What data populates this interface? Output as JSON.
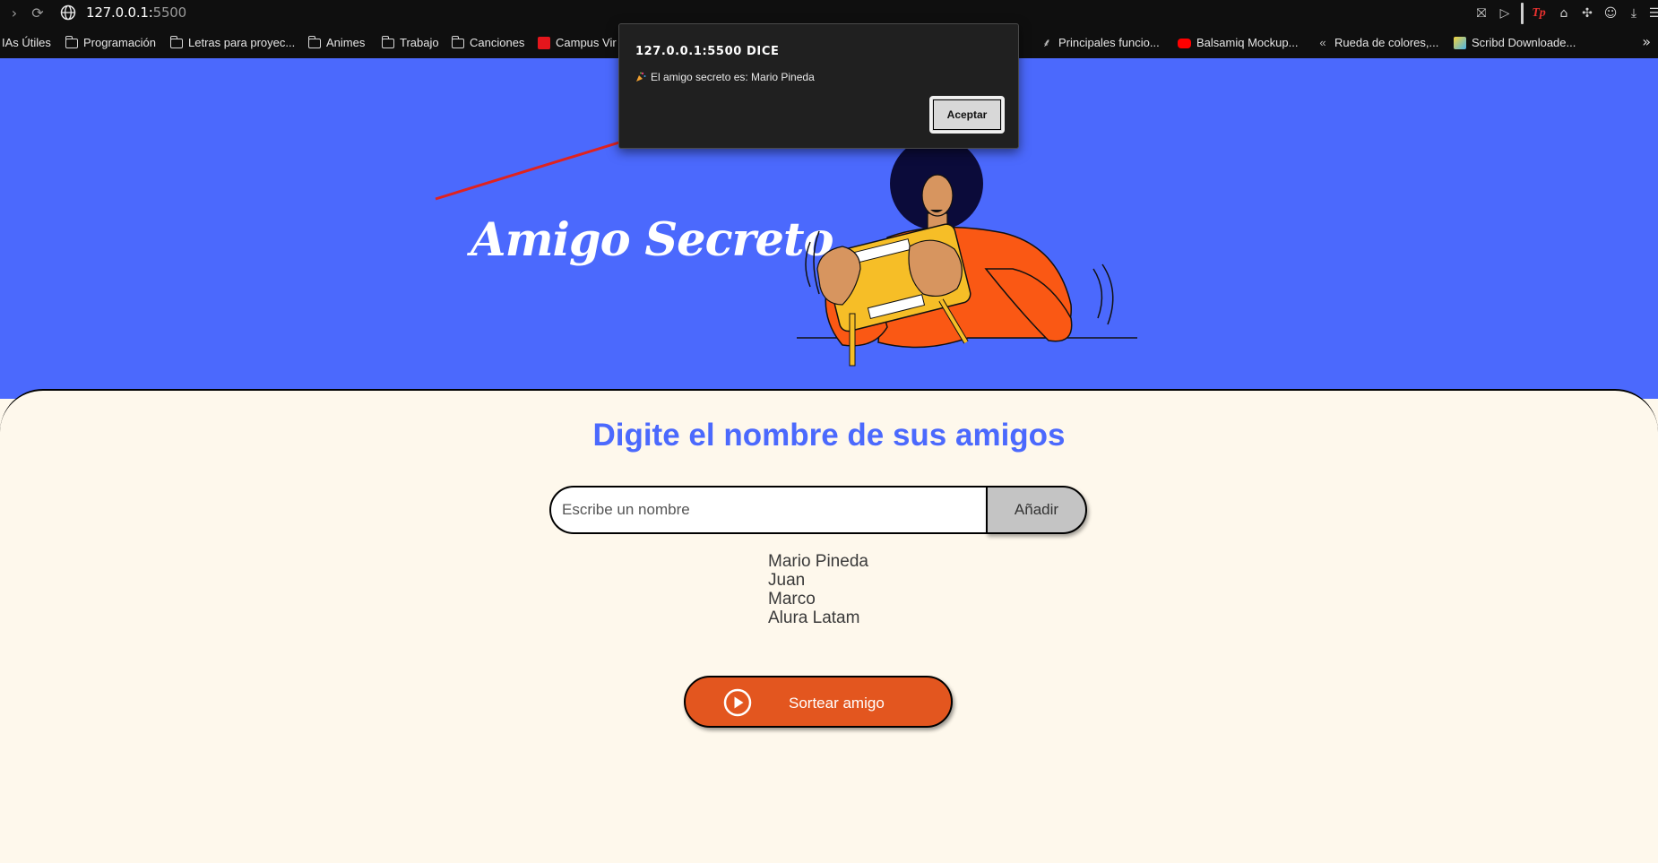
{
  "browser": {
    "url_host": "127.0.0.1:",
    "url_port": "5500",
    "bookmarks": [
      {
        "label": "IAs Útiles",
        "icon": "none"
      },
      {
        "label": "Programación",
        "icon": "folder-icon"
      },
      {
        "label": "Letras para proyec...",
        "icon": "folder-icon"
      },
      {
        "label": "Animes",
        "icon": "folder-icon"
      },
      {
        "label": "Trabajo",
        "icon": "folder-icon"
      },
      {
        "label": "Canciones",
        "icon": "folder-icon"
      },
      {
        "label": "Campus Vir",
        "icon": "campus-favicon"
      },
      {
        "label": "Principales funcio...",
        "icon": "feather-favicon"
      },
      {
        "label": "Balsamiq Mockup...",
        "icon": "youtube-favicon"
      },
      {
        "label": "Rueda de colores,...",
        "icon": "color-wheel-favicon"
      },
      {
        "label": "Scribd Downloade...",
        "icon": "scribd-favicon"
      }
    ]
  },
  "dialog": {
    "title": "127.0.0.1:5500 DICE",
    "message": "El amigo secreto es: Mario Pineda",
    "ok_label": "Aceptar"
  },
  "hero": {
    "title": "Amigo Secreto"
  },
  "main": {
    "subtitle": "Digite el nombre de sus amigos",
    "input_placeholder": "Escribe un nombre",
    "add_label": "Añadir",
    "friends": [
      "Mario Pineda",
      "Juan",
      "Marco",
      "Alura Latam"
    ],
    "draw_label": "Sortear amigo"
  },
  "colors": {
    "hero_bg": "#4b69fd",
    "content_bg": "#fef8ec",
    "accent_orange": "#e3561f",
    "subtitle_blue": "#4b69fd"
  }
}
